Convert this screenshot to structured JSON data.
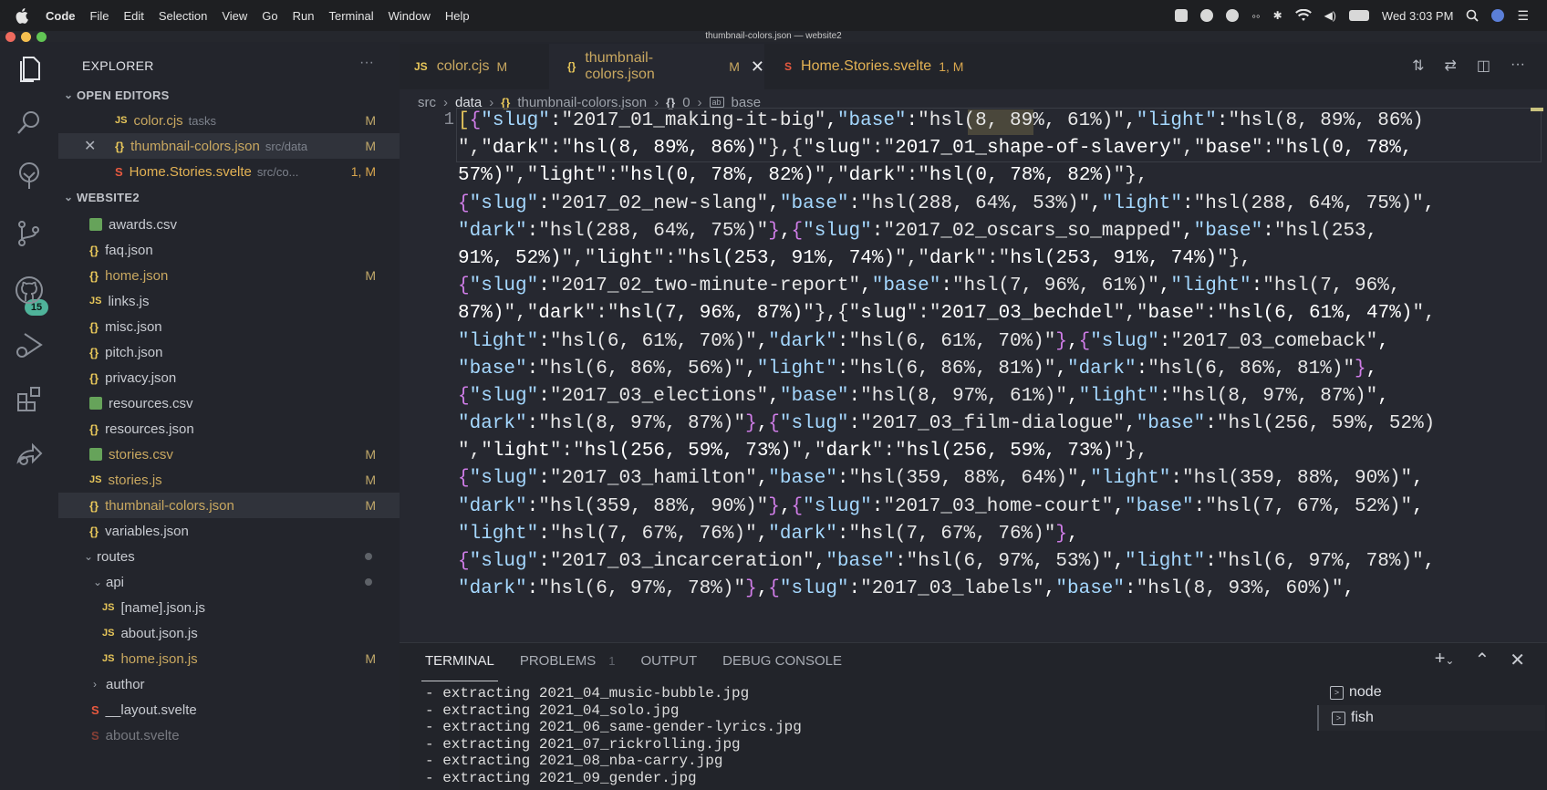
{
  "menubar": {
    "items": [
      "Code",
      "File",
      "Edit",
      "Selection",
      "View",
      "Go",
      "Run",
      "Terminal",
      "Window",
      "Help"
    ],
    "clock": "Wed 3:03 PM"
  },
  "window": {
    "title": "thumbnail-colors.json — website2"
  },
  "activity": {
    "scm_badge": "15"
  },
  "sidebar": {
    "title": "EXPLORER",
    "more": "···",
    "open_editors_label": "OPEN EDITORS",
    "open_editors": [
      {
        "icon": "JS",
        "name": "color.cjs",
        "path": "tasks",
        "status": "M"
      },
      {
        "icon": "{}",
        "name": "thumbnail-colors.json",
        "path": "src/data",
        "status": "M"
      },
      {
        "icon": "S",
        "name": "Home.Stories.svelte",
        "path": "src/co...",
        "status": "1, M"
      }
    ],
    "workspace_label": "WEBSITE2",
    "files": [
      {
        "icon": "csv",
        "name": "awards.csv",
        "status": ""
      },
      {
        "icon": "{}",
        "name": "faq.json",
        "status": ""
      },
      {
        "icon": "{}",
        "name": "home.json",
        "status": "M"
      },
      {
        "icon": "JS",
        "name": "links.js",
        "status": ""
      },
      {
        "icon": "{}",
        "name": "misc.json",
        "status": ""
      },
      {
        "icon": "{}",
        "name": "pitch.json",
        "status": ""
      },
      {
        "icon": "{}",
        "name": "privacy.json",
        "status": ""
      },
      {
        "icon": "csv",
        "name": "resources.csv",
        "status": ""
      },
      {
        "icon": "{}",
        "name": "resources.json",
        "status": ""
      },
      {
        "icon": "csv",
        "name": "stories.csv",
        "status": "M"
      },
      {
        "icon": "JS",
        "name": "stories.js",
        "status": "M"
      },
      {
        "icon": "{}",
        "name": "thumbnail-colors.json",
        "status": "M"
      },
      {
        "icon": "{}",
        "name": "variables.json",
        "status": ""
      }
    ],
    "routes_label": "routes",
    "api_label": "api",
    "api_files": [
      {
        "icon": "JS",
        "name": "[name].json.js",
        "status": ""
      },
      {
        "icon": "JS",
        "name": "about.json.js",
        "status": ""
      },
      {
        "icon": "JS",
        "name": "home.json.js",
        "status": "M"
      }
    ],
    "author_label": "author",
    "layout_file": "__layout.svelte",
    "about_file": "about.svelte"
  },
  "editor": {
    "tabs": [
      {
        "icon": "JS",
        "label": "color.cjs",
        "mark": "M"
      },
      {
        "icon": "{}",
        "label": "thumbnail-colors.json",
        "mark": "M"
      },
      {
        "icon": "S",
        "label": "Home.Stories.svelte",
        "mark": "1, M"
      }
    ],
    "breadcrumb": [
      "src",
      "data",
      "thumbnail-colors.json",
      "0",
      "base"
    ],
    "line_number": "1",
    "code_lines": [
      "[{\"slug\":\"2017_01_making-it-big\",\"base\":\"hsl(8, 89%, 61%)\",\"light\":\"hsl(8, 89%, 86%)",
      "\",\"dark\":\"hsl(8, 89%, 86%)\"},{\"slug\":\"2017_01_shape-of-slavery\",\"base\":\"hsl(0, 78%,",
      "57%)\",\"light\":\"hsl(0, 78%, 82%)\",\"dark\":\"hsl(0, 78%, 82%)\"},",
      "{\"slug\":\"2017_02_new-slang\",\"base\":\"hsl(288, 64%, 53%)\",\"light\":\"hsl(288, 64%, 75%)\",",
      "\"dark\":\"hsl(288, 64%, 75%)\"},{\"slug\":\"2017_02_oscars_so_mapped\",\"base\":\"hsl(253,",
      "91%, 52%)\",\"light\":\"hsl(253, 91%, 74%)\",\"dark\":\"hsl(253, 91%, 74%)\"},",
      "{\"slug\":\"2017_02_two-minute-report\",\"base\":\"hsl(7, 96%, 61%)\",\"light\":\"hsl(7, 96%,",
      "87%)\",\"dark\":\"hsl(7, 96%, 87%)\"},{\"slug\":\"2017_03_bechdel\",\"base\":\"hsl(6, 61%, 47%)\",",
      "\"light\":\"hsl(6, 61%, 70%)\",\"dark\":\"hsl(6, 61%, 70%)\"},{\"slug\":\"2017_03_comeback\",",
      "\"base\":\"hsl(6, 86%, 56%)\",\"light\":\"hsl(6, 86%, 81%)\",\"dark\":\"hsl(6, 86%, 81%)\"},",
      "{\"slug\":\"2017_03_elections\",\"base\":\"hsl(8, 97%, 61%)\",\"light\":\"hsl(8, 97%, 87%)\",",
      "\"dark\":\"hsl(8, 97%, 87%)\"},{\"slug\":\"2017_03_film-dialogue\",\"base\":\"hsl(256, 59%, 52%)",
      "\",\"light\":\"hsl(256, 59%, 73%)\",\"dark\":\"hsl(256, 59%, 73%)\"},",
      "{\"slug\":\"2017_03_hamilton\",\"base\":\"hsl(359, 88%, 64%)\",\"light\":\"hsl(359, 88%, 90%)\",",
      "\"dark\":\"hsl(359, 88%, 90%)\"},{\"slug\":\"2017_03_home-court\",\"base\":\"hsl(7, 67%, 52%)\",",
      "\"light\":\"hsl(7, 67%, 76%)\",\"dark\":\"hsl(7, 67%, 76%)\"},",
      "{\"slug\":\"2017_03_incarceration\",\"base\":\"hsl(6, 97%, 53%)\",\"light\":\"hsl(6, 97%, 78%)\",",
      "\"dark\":\"hsl(6, 97%, 78%)\"},{\"slug\":\"2017_03_labels\",\"base\":\"hsl(8, 93%, 60%)\","
    ]
  },
  "panel": {
    "tabs": [
      "TERMINAL",
      "PROBLEMS",
      "OUTPUT",
      "DEBUG CONSOLE"
    ],
    "problems_count": "1",
    "terminal_lines": [
      "- extracting 2021_04_music-bubble.jpg",
      "- extracting 2021_04_solo.jpg",
      "- extracting 2021_06_same-gender-lyrics.jpg",
      "- extracting 2021_07_rickrolling.jpg",
      "- extracting 2021_08_nba-carry.jpg",
      "- extracting 2021_09_gender.jpg"
    ],
    "terminals": [
      "node",
      "fish"
    ]
  },
  "colors": {
    "accent_yellow": "#e6c65c",
    "key_blue": "#a5d8ff",
    "bracket_purple": "#d07de8",
    "modified": "#c9a860",
    "svelte_red": "#e8593f",
    "badge_green": "#4fb39a"
  }
}
